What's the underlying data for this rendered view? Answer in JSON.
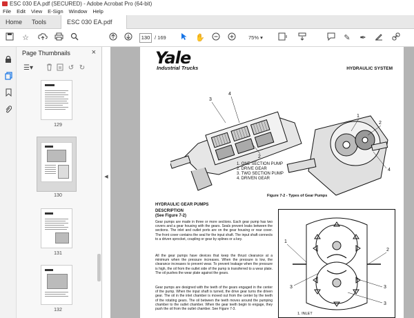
{
  "window": {
    "title": "ESC 030 EA.pdf (SECURED) - Adobe Acrobat Pro (64-bit)"
  },
  "menu": {
    "items": [
      "File",
      "Edit",
      "View",
      "E-Sign",
      "Window",
      "Help"
    ]
  },
  "tabs": [
    {
      "label": "Home"
    },
    {
      "label": "Tools"
    },
    {
      "label": "ESC 030 EA.pdf (SE...",
      "close": "×"
    }
  ],
  "toolbar": {
    "current_page": "130",
    "page_total": "/ 169",
    "zoom": "75%"
  },
  "thumbnails_panel": {
    "title": "Page Thumbnails",
    "close": "×",
    "pages": [
      {
        "label": "129"
      },
      {
        "label": "130",
        "selected": true
      },
      {
        "label": "131"
      },
      {
        "label": "132"
      }
    ]
  },
  "document": {
    "brand": "Yale",
    "brand_sub": "Industrial Trucks",
    "section_header": "HYDRAULIC SYSTEM",
    "figure_legend": [
      "1.  ONE SECTION PUMP",
      "2.  DRIVE GEAR",
      "3.  TWO SECTION PUMP",
      "4.  DRIVEN GEAR"
    ],
    "figure_callouts": [
      "3",
      "4",
      "2",
      "1",
      "2",
      "4"
    ],
    "figure_caption": "Figure 7-2 - Types of Gear Pumps",
    "heading": "HYDRAULIC GEAR PUMPS",
    "subheading_1": "DESCRIPTION",
    "subheading_2": "(See Figure 7-2)",
    "paragraphs": [
      "Gear pumps are made in three or more sections. Each gear pump has two covers and a gear housing with the gears. Seals prevent leaks between the sections. The inlet and outlet ports are on the gear housing or rear cover. The front cover contains the seal for the input shaft. The input shaft connects to a driven sprocket, coupling or gear by splines or a key.",
      "All the gear pumps have devices that keep the thrust clearance at a minimum when the pressure increases. When the pressure is low, the clearance increases to prevent wear. To prevent leakage when the pressure is high, the oil from the outlet side of the pump is transferred to a wear plate. The oil pushes the wear plate against the gears.",
      "Gear pumps are designed with the teeth of the gears engaged in the center of the pump. When the input shaft is turned, the drive gear turns the driven gear. The oil in the inlet chamber is moved out from the center by the teeth of the rotating gears. The oil between the teeth moves around the pumping chamber to the outlet chamber. When the gear teeth begin to engage, they push the oil from the outlet chamber. See Figure 7-3."
    ],
    "gear_callouts": [
      "1",
      "2",
      "3",
      "3",
      "3"
    ],
    "gear_legend": "1.  INLET"
  },
  "colors": {
    "accent": "#1473e6",
    "doc_background": "#b4b4b4",
    "app_icon": "#d32f2f"
  }
}
